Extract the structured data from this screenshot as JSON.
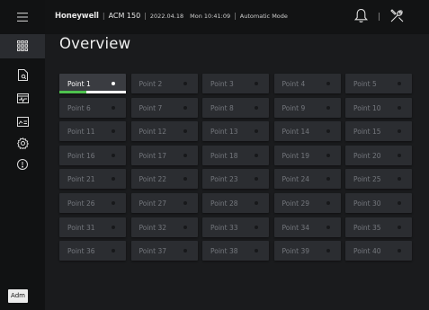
{
  "sidebar": {
    "menu_icon": "hamburger-menu-icon",
    "items": [
      {
        "icon": "grid-dashboard-icon",
        "active": true
      },
      {
        "icon": "document-search-icon",
        "active": false
      },
      {
        "icon": "event-list-icon",
        "active": false
      },
      {
        "icon": "report-chart-icon",
        "active": false
      },
      {
        "icon": "settings-gear-icon",
        "active": false
      },
      {
        "icon": "alert-circle-icon",
        "active": false
      }
    ],
    "user_badge": "Adm"
  },
  "header": {
    "brand": "Honeywell",
    "device": "ACM 150",
    "date": "2022.04.18",
    "time": "Mon 10:41:09",
    "mode": "Automatic Mode",
    "bell_icon": "notification-bell-icon",
    "tools_icon": "tools-settings-icon"
  },
  "page": {
    "title": "Overview"
  },
  "points": [
    {
      "label": "Point 1",
      "selected": true
    },
    {
      "label": "Point 2"
    },
    {
      "label": "Point 3"
    },
    {
      "label": "Point 4"
    },
    {
      "label": "Point 5"
    },
    {
      "label": "Point 6"
    },
    {
      "label": "Point 7"
    },
    {
      "label": "Point 8"
    },
    {
      "label": "Point 9"
    },
    {
      "label": "Point 10"
    },
    {
      "label": "Point 11"
    },
    {
      "label": "Point 12"
    },
    {
      "label": "Point 13"
    },
    {
      "label": "Point 14"
    },
    {
      "label": "Point 15"
    },
    {
      "label": "Point 16"
    },
    {
      "label": "Point 17"
    },
    {
      "label": "Point 18"
    },
    {
      "label": "Point 19"
    },
    {
      "label": "Point 20"
    },
    {
      "label": "Point 21"
    },
    {
      "label": "Point 22"
    },
    {
      "label": "Point 23"
    },
    {
      "label": "Point 24"
    },
    {
      "label": "Point 25"
    },
    {
      "label": "Point 26"
    },
    {
      "label": "Point 27"
    },
    {
      "label": "Point 28"
    },
    {
      "label": "Point 29"
    },
    {
      "label": "Point 30"
    },
    {
      "label": "Point 31"
    },
    {
      "label": "Point 32"
    },
    {
      "label": "Point 33"
    },
    {
      "label": "Point 34"
    },
    {
      "label": "Point 35"
    },
    {
      "label": "Point 36"
    },
    {
      "label": "Point 37"
    },
    {
      "label": "Point 38"
    },
    {
      "label": "Point 39"
    },
    {
      "label": "Point 40"
    }
  ],
  "colors": {
    "background": "#1a1b1d",
    "tile": "#2b2d31",
    "tile_selected": "#3a3c41",
    "status_green": "#4ec24e"
  }
}
